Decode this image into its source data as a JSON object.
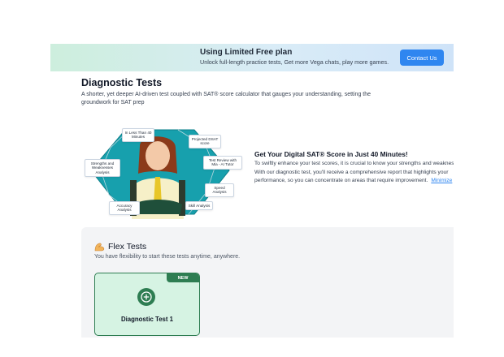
{
  "banner": {
    "title": "Using Limited Free plan",
    "subtitle": "Unlock full-length practice tests, Get more Vega chats, play more games.",
    "contact_label": "Contact Us"
  },
  "diagnostic": {
    "title": "Diagnostic Tests",
    "description": "A shorter, yet deeper AI-driven test coupled with SAT® score calculator that gauges your understanding, setting the groundwork for SAT prep"
  },
  "illustration": {
    "labels": {
      "less_than": "In Less Than 40 Minutes",
      "projected": "Projected DSAT score",
      "strengths": "Strengths and Weaknesses Analysis",
      "test_review": "Test Review with Mia - AI Tutor",
      "speed": "Speed Analysis",
      "accuracy": "Accuracy Analysis",
      "skill": "Skill Analysis"
    }
  },
  "promo": {
    "title": "Get Your Digital SAT® Score in Just 40 Minutes!",
    "text": "To swiftly enhance your test scores, it is crucial to know your strengths and weaknesses. With our diagnostic test, you'll receive a comprehensive report that highlights your performance, so you can concentrate on areas that require improvement.",
    "minimize_label": "Minimize"
  },
  "flex": {
    "title": "Flex Tests",
    "subtitle": "You have flexibility to start these tests anytime, anywhere.",
    "card": {
      "badge": "NEW",
      "title": "Diagnostic Test 1"
    }
  },
  "colors": {
    "accent_blue": "#2f86f0",
    "accent_green": "#2e7d52",
    "card_bg": "#d6f3e3"
  }
}
